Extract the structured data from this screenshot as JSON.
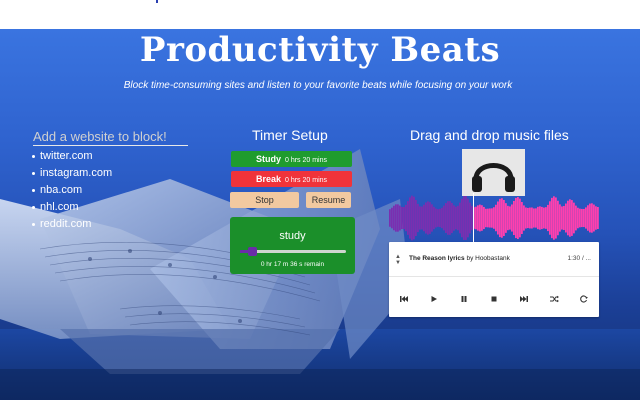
{
  "app": {
    "title": "Productivity Beats",
    "subtitle": "Block time-consuming sites and listen to your favorite beats while focusing on your work"
  },
  "blocker": {
    "placeholder": "Add a website to block!",
    "sites": [
      "twitter.com",
      "instagram.com",
      "nba.com",
      "nhl.com",
      "reddit.com"
    ]
  },
  "timer": {
    "heading": "Timer Setup",
    "study_label": "Study",
    "study_duration": "0 hrs  20 mins",
    "break_label": "Break",
    "break_duration": "0 hrs  20 mins",
    "stop_label": "Stop",
    "resume_label": "Resume",
    "mode": "study",
    "remaining": "0 hr 17 m 36 s remain",
    "progress_fraction": 0.12,
    "colors": {
      "study": "#1f9c2e",
      "break": "#f0333a",
      "button": "#f2c9a0",
      "progress": "#6a2ca8"
    }
  },
  "music": {
    "heading": "Drag and drop music files",
    "track_title": "The Reason lyrics",
    "track_by": "by Hoobastank",
    "track_time": "1:30 / ...",
    "played_fraction": 0.4,
    "icons": [
      "previous-icon",
      "play-icon",
      "pause-icon",
      "stop-icon",
      "next-icon",
      "shuffle-icon",
      "repeat-icon"
    ],
    "colors": {
      "wave_played": "#7a2fb0",
      "wave_unplayed": "#ff3fae"
    }
  }
}
